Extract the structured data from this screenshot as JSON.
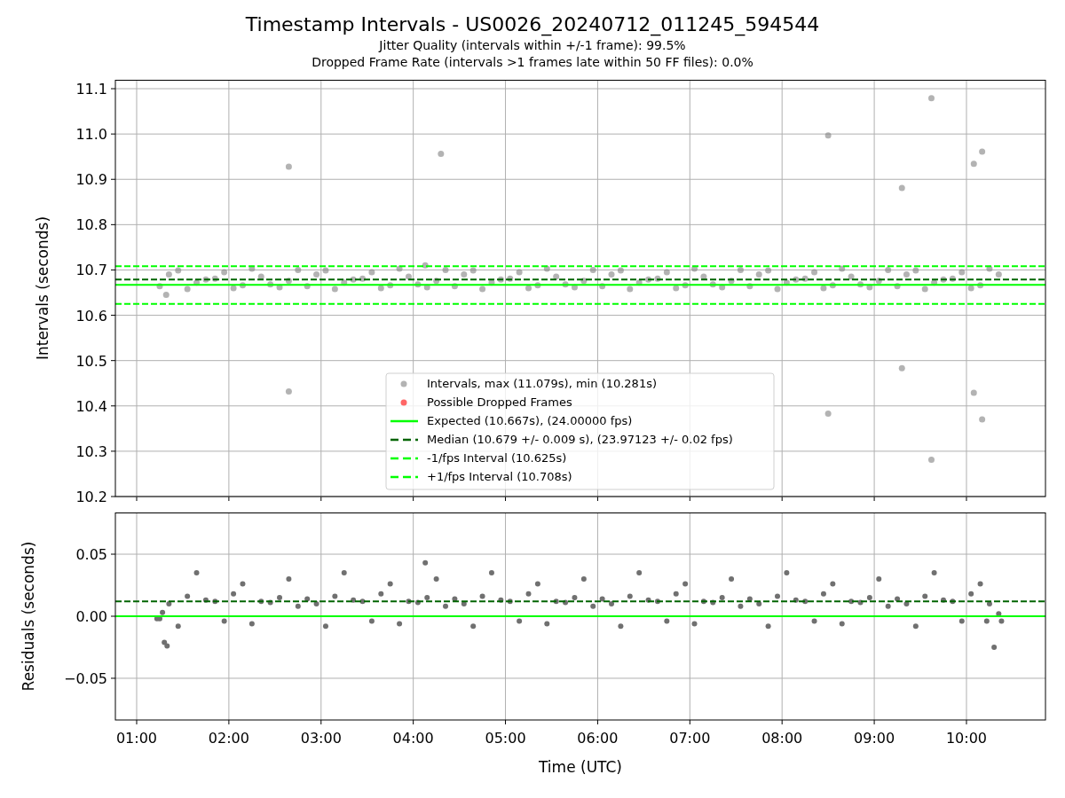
{
  "figure": {
    "title": "Timestamp Intervals - US0026_20240712_011245_594544",
    "subtitles": [
      "Jitter Quality (intervals within +/-1 frame): 99.5%",
      "Dropped Frame Rate (intervals >1 frames late within 50 FF files): 0.0%"
    ]
  },
  "intervals_plot": {
    "chart_data": {
      "type": "scatter",
      "ylabel": "Intervals (seconds)",
      "xlim": [
        0.769,
        10.857
      ],
      "ylim": [
        10.2,
        11.1196
      ],
      "grid": true,
      "legend": "lower center",
      "yticks": [
        {
          "value": 10.2,
          "label": "10.2"
        },
        {
          "value": 10.3,
          "label": "10.3"
        },
        {
          "value": 10.4,
          "label": "10.4"
        },
        {
          "value": 10.5,
          "label": "10.5"
        },
        {
          "value": 10.6,
          "label": "10.6"
        },
        {
          "value": 10.7,
          "label": "10.7"
        },
        {
          "value": 10.8,
          "label": "10.8"
        },
        {
          "value": 10.9,
          "label": "10.9"
        },
        {
          "value": 11.0,
          "label": "11.0"
        },
        {
          "value": 11.1,
          "label": "11.1"
        }
      ],
      "series": [
        {
          "name": "Intervals, max (11.079s), min (10.281s)",
          "color": "#808080",
          "x": [
            1.25,
            1.45,
            1.65,
            1.85,
            2.05,
            2.25,
            2.45,
            2.65,
            2.85,
            3.05,
            3.25,
            3.45,
            3.65,
            3.85,
            4.05,
            4.25,
            4.45,
            4.65,
            4.85,
            5.05,
            5.25,
            5.45,
            5.65,
            5.85,
            6.05,
            6.25,
            6.45,
            6.65,
            6.85,
            7.05,
            7.25,
            7.45,
            7.65,
            7.85,
            8.05,
            8.25,
            8.45,
            8.65,
            8.85,
            9.05,
            9.25,
            9.45,
            9.65,
            9.85,
            10.05,
            10.25,
            1.35,
            1.55,
            1.75,
            1.95,
            2.15,
            2.35,
            2.55,
            2.75,
            2.95,
            3.15,
            3.35,
            3.55,
            3.75,
            3.95,
            4.15,
            4.35,
            4.55,
            4.75,
            4.95,
            5.15,
            5.35,
            5.55,
            5.75,
            5.95,
            6.15,
            6.35,
            6.55,
            6.75,
            6.95,
            7.15,
            7.35,
            7.55,
            7.75,
            7.95,
            8.15,
            8.35,
            8.55,
            8.75,
            8.95,
            9.15,
            9.35,
            9.55,
            9.75,
            9.95,
            10.15,
            2.65,
            2.65,
            4.3,
            8.5,
            8.5,
            9.3,
            9.3,
            9.62,
            9.62,
            10.08,
            10.08,
            10.17,
            10.17,
            4.13,
            1.32,
            10.35
          ],
          "values": [
            10.664,
            10.699,
            10.672,
            10.681,
            10.66,
            10.703,
            10.668,
            10.676,
            10.664,
            10.699,
            10.672,
            10.681,
            10.66,
            10.703,
            10.668,
            10.676,
            10.664,
            10.699,
            10.672,
            10.681,
            10.66,
            10.703,
            10.668,
            10.676,
            10.664,
            10.699,
            10.672,
            10.681,
            10.66,
            10.703,
            10.668,
            10.676,
            10.664,
            10.699,
            10.672,
            10.681,
            10.66,
            10.703,
            10.668,
            10.676,
            10.664,
            10.699,
            10.672,
            10.681,
            10.66,
            10.703,
            10.69,
            10.658,
            10.679,
            10.695,
            10.666,
            10.685,
            10.662,
            10.7,
            10.69,
            10.658,
            10.679,
            10.695,
            10.666,
            10.685,
            10.662,
            10.7,
            10.69,
            10.658,
            10.679,
            10.695,
            10.666,
            10.685,
            10.662,
            10.7,
            10.69,
            10.658,
            10.679,
            10.695,
            10.666,
            10.685,
            10.662,
            10.7,
            10.69,
            10.658,
            10.679,
            10.695,
            10.666,
            10.685,
            10.662,
            10.7,
            10.69,
            10.658,
            10.679,
            10.695,
            10.666,
            10.928,
            10.432,
            10.956,
            10.997,
            10.383,
            10.881,
            10.483,
            11.079,
            10.281,
            10.934,
            10.429,
            10.961,
            10.37,
            10.71,
            10.645,
            10.69
          ]
        },
        {
          "name": "Possible Dropped Frames",
          "color": "#ff0000"
        }
      ],
      "ref_lines": [
        {
          "axis": "y",
          "value": 10.667,
          "label": "Expected (10.667s), (24.00000 fps)",
          "color": "#00ff00"
        },
        {
          "axis": "y",
          "value": 10.679,
          "label": "Median (10.679 +/- 0.009 s), (23.97123 +/- 0.02 fps)",
          "color": "#006400"
        },
        {
          "axis": "y",
          "value": 10.625,
          "label": "-1/fps Interval (10.625s)",
          "color": "#00ff00"
        },
        {
          "axis": "y",
          "value": 10.708,
          "label": "+1/fps Interval (10.708s)",
          "color": "#00ff00"
        }
      ]
    }
  },
  "residuals_plot": {
    "chart_data": {
      "type": "scatter",
      "xlabel": "Time (UTC)",
      "ylabel": "Residuals (seconds)",
      "xlim": [
        0.769,
        10.857
      ],
      "ylim": [
        -0.0836,
        0.0836
      ],
      "xticks": [
        {
          "value": 1,
          "label": "01:00"
        },
        {
          "value": 2,
          "label": "02:00"
        },
        {
          "value": 3,
          "label": "03:00"
        },
        {
          "value": 4,
          "label": "04:00"
        },
        {
          "value": 5,
          "label": "05:00"
        },
        {
          "value": 6,
          "label": "06:00"
        },
        {
          "value": 7,
          "label": "07:00"
        },
        {
          "value": 8,
          "label": "08:00"
        },
        {
          "value": 9,
          "label": "09:00"
        },
        {
          "value": 10,
          "label": "10:00"
        }
      ],
      "yticks": [
        {
          "value": -0.05,
          "label": "−0.05"
        },
        {
          "value": 0,
          "label": "0.00"
        },
        {
          "value": 0.05,
          "label": "0.05"
        }
      ],
      "grid": true,
      "series": [
        {
          "color": "#707070",
          "x": [
            1.25,
            1.45,
            1.65,
            1.85,
            2.05,
            2.25,
            2.45,
            2.65,
            2.85,
            3.05,
            3.25,
            3.45,
            3.65,
            3.85,
            4.05,
            4.25,
            4.45,
            4.65,
            4.85,
            5.05,
            5.25,
            5.45,
            5.65,
            5.85,
            6.05,
            6.25,
            6.45,
            6.65,
            6.85,
            7.05,
            7.25,
            7.45,
            7.65,
            7.85,
            8.05,
            8.25,
            8.45,
            8.65,
            8.85,
            9.05,
            9.25,
            9.45,
            9.65,
            9.85,
            10.05,
            10.25,
            1.35,
            1.55,
            1.75,
            1.95,
            2.15,
            2.35,
            2.55,
            2.75,
            2.95,
            3.15,
            3.35,
            3.55,
            3.75,
            3.95,
            4.15,
            4.35,
            4.55,
            4.75,
            4.95,
            5.15,
            5.35,
            5.55,
            5.75,
            5.95,
            6.15,
            6.35,
            6.55,
            6.75,
            6.95,
            7.15,
            7.35,
            7.55,
            7.75,
            7.95,
            8.15,
            8.35,
            8.55,
            8.75,
            8.95,
            9.15,
            9.35,
            9.55,
            9.75,
            9.95,
            10.15,
            1.22,
            1.28,
            1.3,
            1.33,
            10.22,
            10.3,
            10.35,
            10.38,
            4.13
          ],
          "values": [
            -0.002,
            -0.008,
            0.035,
            0.012,
            0.018,
            -0.006,
            0.011,
            0.03,
            0.014,
            -0.008,
            0.035,
            0.012,
            0.018,
            -0.006,
            0.011,
            0.03,
            0.014,
            -0.008,
            0.035,
            0.012,
            0.018,
            -0.006,
            0.011,
            0.03,
            0.014,
            -0.008,
            0.035,
            0.012,
            0.018,
            -0.006,
            0.011,
            0.03,
            0.014,
            -0.008,
            0.035,
            0.012,
            0.018,
            -0.006,
            0.011,
            0.03,
            0.014,
            -0.008,
            0.035,
            0.012,
            0.018,
            0.01,
            0.01,
            0.016,
            0.013,
            -0.004,
            0.026,
            0.012,
            0.015,
            0.008,
            0.01,
            0.016,
            0.013,
            -0.004,
            0.026,
            0.012,
            0.015,
            0.008,
            0.01,
            0.016,
            0.013,
            -0.004,
            0.026,
            0.012,
            0.015,
            0.008,
            0.01,
            0.016,
            0.013,
            -0.004,
            0.026,
            0.012,
            0.015,
            0.008,
            0.01,
            0.016,
            0.013,
            -0.004,
            0.026,
            0.012,
            0.015,
            0.008,
            0.01,
            0.016,
            0.013,
            -0.004,
            0.026,
            -0.002,
            0.003,
            -0.021,
            -0.024,
            -0.004,
            -0.025,
            0.002,
            -0.004,
            0.043
          ]
        }
      ],
      "ref_lines": [
        {
          "axis": "y",
          "value": 0.012,
          "color": "#006400"
        },
        {
          "axis": "y",
          "value": 0,
          "color": "#00ff00"
        }
      ]
    }
  }
}
